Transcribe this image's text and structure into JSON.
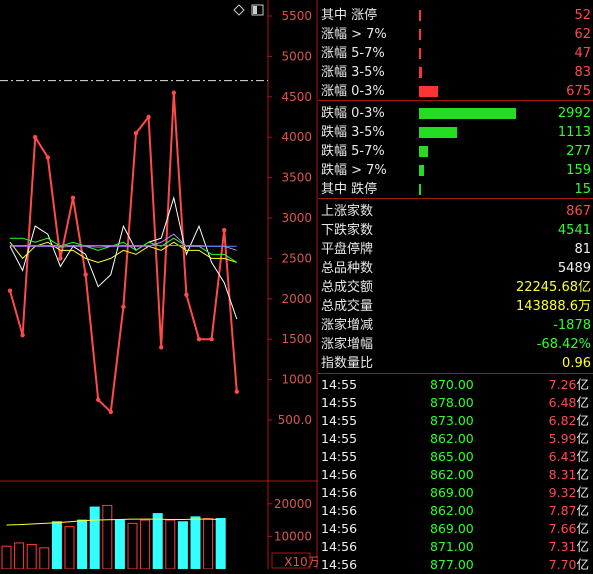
{
  "toolbar": {
    "diamond_icon": "diamond-icon",
    "panel_icon": "panel-toggle-icon"
  },
  "price_axis": {
    "ticks": [
      "5500",
      "5000",
      "4500",
      "4000",
      "3500",
      "3000",
      "2500",
      "2000",
      "1500",
      "1000",
      "500.0"
    ]
  },
  "volume_axis": {
    "ticks": [
      "20000",
      "10000"
    ],
    "unit": "X10万"
  },
  "chart_data": {
    "type": "line",
    "price_panel": {
      "y_range": [
        200,
        5700
      ],
      "reference_level": 4700,
      "x_count": 22,
      "series": [
        {
          "color": "#ff4a4a",
          "values": [
            2100,
            1550,
            4000,
            3750,
            2500,
            3250,
            2300,
            750,
            600,
            1900,
            4050,
            4250,
            1400,
            4550,
            2050,
            1500,
            1500,
            2850,
            850
          ]
        },
        {
          "color": "#ffffff",
          "values": [
            2650,
            2350,
            2900,
            2800,
            2400,
            2650,
            2550,
            2150,
            2300,
            2900,
            2600,
            2700,
            2750,
            3250,
            2550,
            2900,
            2450,
            2200,
            1750
          ]
        },
        {
          "color": "#ffff33",
          "values": [
            2700,
            2500,
            2650,
            2700,
            2600,
            2600,
            2500,
            2450,
            2500,
            2600,
            2550,
            2650,
            2600,
            2700,
            2600,
            2600,
            2500,
            2500,
            2450
          ]
        },
        {
          "color": "#2dff2d",
          "values": [
            2750,
            2750,
            2700,
            2750,
            2650,
            2700,
            2650,
            2600,
            2650,
            2700,
            2600,
            2700,
            2650,
            2750,
            2650,
            2650,
            2550,
            2550,
            2450
          ]
        },
        {
          "color": "#c080ff",
          "values": [
            2650,
            2650,
            2650,
            2650,
            2640,
            2650,
            2650,
            2640,
            2650,
            2650,
            2650,
            2650,
            2700,
            2800,
            2650,
            2650,
            2650,
            2650,
            2600
          ]
        },
        {
          "color": "#5a8cff",
          "values": [
            2660,
            2660,
            2660,
            2660,
            2660,
            2660,
            2660,
            2660,
            2660,
            2660,
            2660,
            2660,
            2660,
            2660,
            2660,
            2660,
            2650,
            2650,
            2650
          ]
        }
      ]
    },
    "volume_panel": {
      "y_range": [
        0,
        27000
      ],
      "bars": [
        {
          "value": 7000,
          "fill": "#000"
        },
        {
          "value": 8000,
          "fill": "#000"
        },
        {
          "value": 7500,
          "fill": "#000"
        },
        {
          "value": 6500,
          "fill": "#000"
        },
        {
          "value": 14500,
          "fill": "#3ff"
        },
        {
          "value": 13000,
          "fill": "#000"
        },
        {
          "value": 15000,
          "fill": "#3ff"
        },
        {
          "value": 19000,
          "fill": "#3ff"
        },
        {
          "value": 19500,
          "fill": "#000"
        },
        {
          "value": 15000,
          "fill": "#3ff"
        },
        {
          "value": 14000,
          "fill": "#000"
        },
        {
          "value": 15000,
          "fill": "#000"
        },
        {
          "value": 17000,
          "fill": "#3ff"
        },
        {
          "value": 15000,
          "fill": "#000"
        },
        {
          "value": 14500,
          "fill": "#3ff"
        },
        {
          "value": 16000,
          "fill": "#3ff"
        },
        {
          "value": 15500,
          "fill": "#000"
        },
        {
          "value": 15500,
          "fill": "#3ff"
        }
      ],
      "avg_line": [
        13500,
        13600,
        13800,
        14000,
        14200,
        14500,
        14800,
        15000,
        15100,
        15200,
        15300,
        15300,
        15300,
        15200,
        15200,
        15300,
        15300,
        15200
      ]
    }
  },
  "breadth": {
    "up_rows": [
      {
        "label": "其中 涨停",
        "value": "52",
        "bar": 0.006
      },
      {
        "label": "涨幅 > 7%",
        "value": "62",
        "bar": 0.007
      },
      {
        "label": "涨幅 5-7%",
        "value": "47",
        "bar": 0.006
      },
      {
        "label": "涨幅 3-5%",
        "value": "83",
        "bar": 0.012
      },
      {
        "label": "涨幅 0-3%",
        "value": "675",
        "bar": 0.07
      }
    ],
    "down_rows": [
      {
        "label": "跌幅 0-3%",
        "value": "2992",
        "bar": 0.36
      },
      {
        "label": "跌幅 3-5%",
        "value": "1113",
        "bar": 0.14
      },
      {
        "label": "跌幅 5-7%",
        "value": "277",
        "bar": 0.035
      },
      {
        "label": "跌幅 > 7%",
        "value": "159",
        "bar": 0.02
      },
      {
        "label": "其中 跌停",
        "value": "15",
        "bar": 0.003
      }
    ],
    "up_color": "#ff3333",
    "down_color": "#22dd22"
  },
  "stats": [
    {
      "label": "上涨家数",
      "value": "867",
      "color": "red"
    },
    {
      "label": "下跌家数",
      "value": "4541",
      "color": "green"
    },
    {
      "label": "平盘停牌",
      "value": "81",
      "color": "white"
    },
    {
      "label": "总品种数",
      "value": "5489",
      "color": "white"
    },
    {
      "label": "总成交额",
      "value": "22245.68亿",
      "color": "yellow"
    },
    {
      "label": "总成交量",
      "value": "143888.6万",
      "color": "yellow"
    },
    {
      "label": "涨家增减",
      "value": "-1878",
      "color": "green"
    },
    {
      "label": "涨家增幅",
      "value": "-68.42%",
      "color": "green"
    },
    {
      "label": "指数量比",
      "value": "0.96",
      "color": "yellow"
    }
  ],
  "ticks": [
    {
      "time": "14:55",
      "price": "870.00",
      "amount": "7.26",
      "unit": "亿"
    },
    {
      "time": "14:55",
      "price": "878.00",
      "amount": "6.48",
      "unit": "亿"
    },
    {
      "time": "14:55",
      "price": "873.00",
      "amount": "6.82",
      "unit": "亿"
    },
    {
      "time": "14:55",
      "price": "862.00",
      "amount": "5.99",
      "unit": "亿"
    },
    {
      "time": "14:55",
      "price": "865.00",
      "amount": "6.43",
      "unit": "亿"
    },
    {
      "time": "14:56",
      "price": "862.00",
      "amount": "8.31",
      "unit": "亿"
    },
    {
      "time": "14:56",
      "price": "869.00",
      "amount": "9.32",
      "unit": "亿"
    },
    {
      "time": "14:56",
      "price": "862.00",
      "amount": "7.87",
      "unit": "亿"
    },
    {
      "time": "14:56",
      "price": "869.00",
      "amount": "7.66",
      "unit": "亿"
    },
    {
      "time": "14:56",
      "price": "871.00",
      "amount": "7.31",
      "unit": "亿"
    },
    {
      "time": "14:56",
      "price": "877.00",
      "amount": "7.70",
      "unit": "亿"
    }
  ]
}
